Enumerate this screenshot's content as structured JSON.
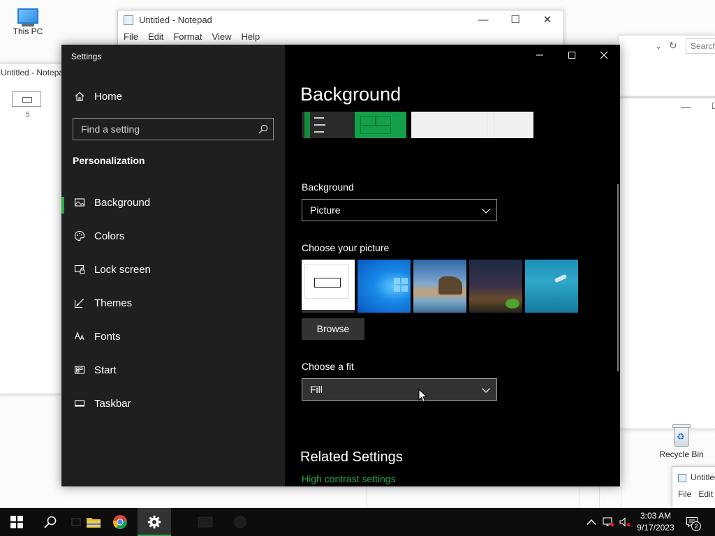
{
  "desktop": {
    "icons": {
      "this_pc": "This PC",
      "recycle_bin": "Recycle Bin"
    },
    "notepad_main": {
      "title": "Untitled - Notepad",
      "menu": [
        "File",
        "Edit",
        "Format",
        "View",
        "Help"
      ]
    },
    "notepad_left": {
      "title": "Untitled - Notepad",
      "doc_label": "5"
    },
    "explorer": {
      "search_placeholder": "Search"
    },
    "notepad_small": {
      "title": "Untitled",
      "menu": [
        "File",
        "Edit"
      ]
    }
  },
  "settings": {
    "window_title": "Settings",
    "sidebar": {
      "home_label": "Home",
      "search_placeholder": "Find a setting",
      "section_title": "Personalization",
      "items": [
        {
          "label": "Background",
          "icon": "picture-icon",
          "selected": true
        },
        {
          "label": "Colors",
          "icon": "palette-icon",
          "selected": false
        },
        {
          "label": "Lock screen",
          "icon": "lock-screen-icon",
          "selected": false
        },
        {
          "label": "Themes",
          "icon": "themes-icon",
          "selected": false
        },
        {
          "label": "Fonts",
          "icon": "fonts-icon",
          "selected": false
        },
        {
          "label": "Start",
          "icon": "start-icon",
          "selected": false
        },
        {
          "label": "Taskbar",
          "icon": "taskbar-icon",
          "selected": false
        }
      ]
    },
    "content": {
      "page_title": "Background",
      "background_label": "Background",
      "background_value": "Picture",
      "choose_picture_label": "Choose your picture",
      "browse_label": "Browse",
      "choose_fit_label": "Choose a fit",
      "fit_value": "Fill",
      "related_title": "Related Settings",
      "related_link": "High contrast settings"
    }
  },
  "taskbar": {
    "pinned": [
      "start-icon",
      "search-icon",
      "task-view-icon",
      "file-explorer-icon",
      "chrome-icon",
      "settings-icon"
    ],
    "clock": {
      "time": "3:03 AM",
      "date": "9/17/2023"
    },
    "notification_count": "2"
  },
  "colors": {
    "accent": "#2aa84a",
    "sidebar_bg": "#1f1f1f",
    "content_bg": "#000000",
    "taskbar_bg": "#0d0d0d"
  }
}
